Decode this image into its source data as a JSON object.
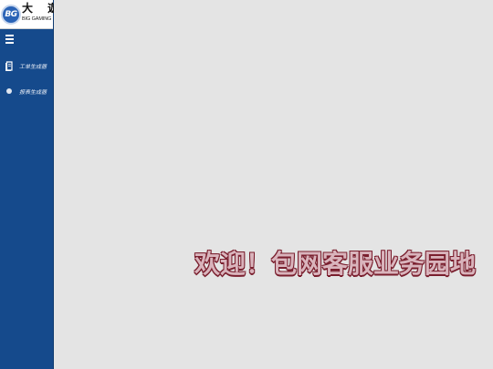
{
  "logo": {
    "badge": "BG",
    "title_cn": "大 遊",
    "subtitle": "BIG GAMING"
  },
  "sidebar": {
    "items": [
      {
        "label": "工单生成器",
        "icon": "document-icon"
      },
      {
        "label": "报表生成器",
        "icon": "dot-icon"
      }
    ]
  },
  "main": {
    "welcome_text": "欢迎！包网客服业务园地"
  },
  "colors": {
    "sidebar_bg": "#154a8c",
    "main_bg": "#e4e4e4",
    "welcome_fill": "#d9b4bc",
    "welcome_outline": "#7a1f2e"
  }
}
